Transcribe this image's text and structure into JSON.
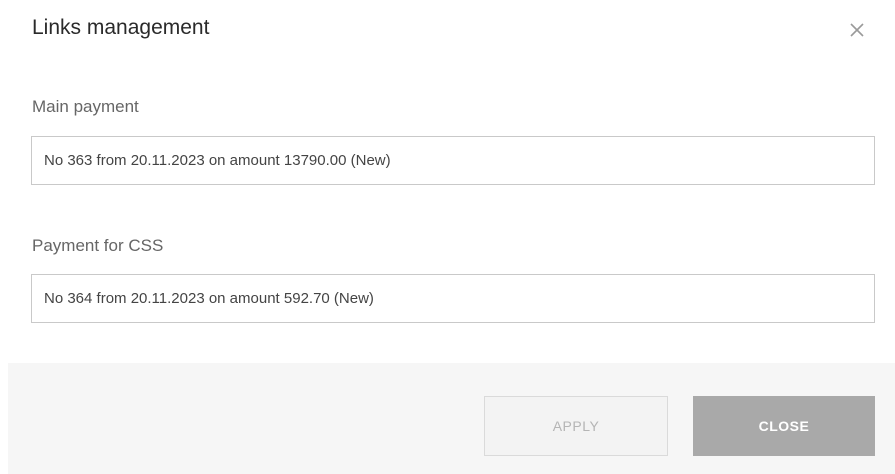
{
  "dialog": {
    "title": "Links management",
    "close_icon": "close-icon"
  },
  "fields": {
    "main_payment": {
      "label": "Main payment",
      "value": "No 363 from 20.11.2023 on amount 13790.00 (New)"
    },
    "css_payment": {
      "label": "Payment for CSS",
      "value": "No 364 from 20.11.2023 on amount 592.70 (New)"
    }
  },
  "buttons": {
    "apply": "APPLY",
    "close": "CLOSE"
  },
  "colors": {
    "footer_bg": "#f6f6f6",
    "apply_bg": "#f3f3f3",
    "close_bg": "#a9a9a9"
  }
}
